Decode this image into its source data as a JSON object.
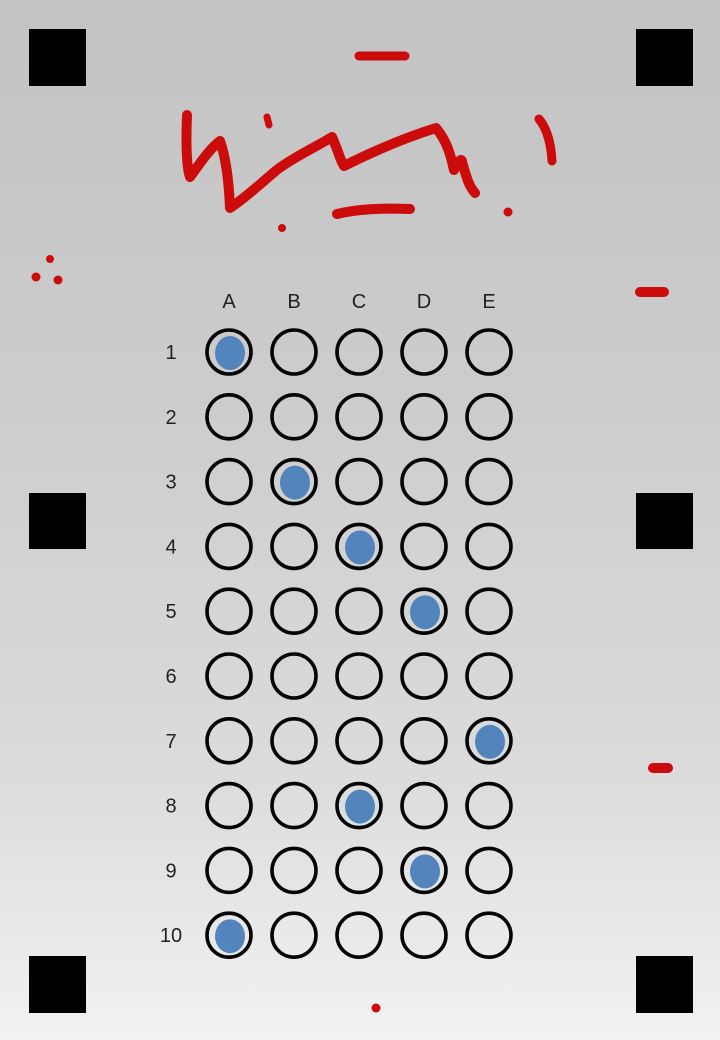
{
  "columns": [
    "A",
    "B",
    "C",
    "D",
    "E"
  ],
  "rows": [
    "1",
    "2",
    "3",
    "4",
    "5",
    "6",
    "7",
    "8",
    "9",
    "10"
  ],
  "answers": [
    "A",
    null,
    "B",
    "C",
    "D",
    null,
    "E",
    "C",
    "D",
    "A"
  ],
  "colors": {
    "bubble_outline": "#050505",
    "fill_mark": "#4a7fb8",
    "ink": "#cc0b0b",
    "registration_marker": "#000000"
  }
}
